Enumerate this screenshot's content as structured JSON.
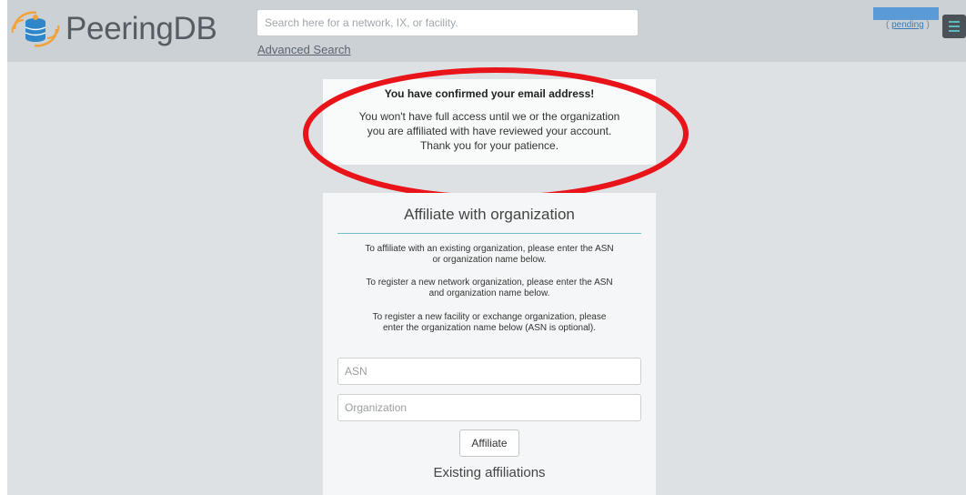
{
  "header": {
    "logo_text": "PeeringDB",
    "search_placeholder": "Search here for a network, IX, or facility.",
    "advanced_search": "Advanced Search",
    "pending_open": "( ",
    "pending_link": "pending",
    "pending_close": " )",
    "menu_icon": "hamburger-menu-icon"
  },
  "notice": {
    "title": "You have confirmed your email address!",
    "line1": "You won't have full access until we or the organization",
    "line2": "you are affiliated with have reviewed your account.",
    "line3": "Thank you for your patience.",
    "highlight_color": "#e8141a"
  },
  "affiliate": {
    "title": "Affiliate with organization",
    "p1_line1": "To affiliate with an existing organization, please enter the ASN",
    "p1_line2": "or organization name below.",
    "p2_line1": "To register a new network organization, please enter the ASN",
    "p2_line2": "and organization name below.",
    "p3_line1": "To register a new facility or exchange organization, please",
    "p3_line2": "enter the organization name below (ASN is optional).",
    "asn_placeholder": "ASN",
    "org_placeholder": "Organization",
    "button_label": "Affiliate",
    "existing_title": "Existing affiliations"
  },
  "colors": {
    "accent": "#6fbfd1",
    "logo_orange": "#f2a23c",
    "logo_blue": "#2f86c9"
  }
}
